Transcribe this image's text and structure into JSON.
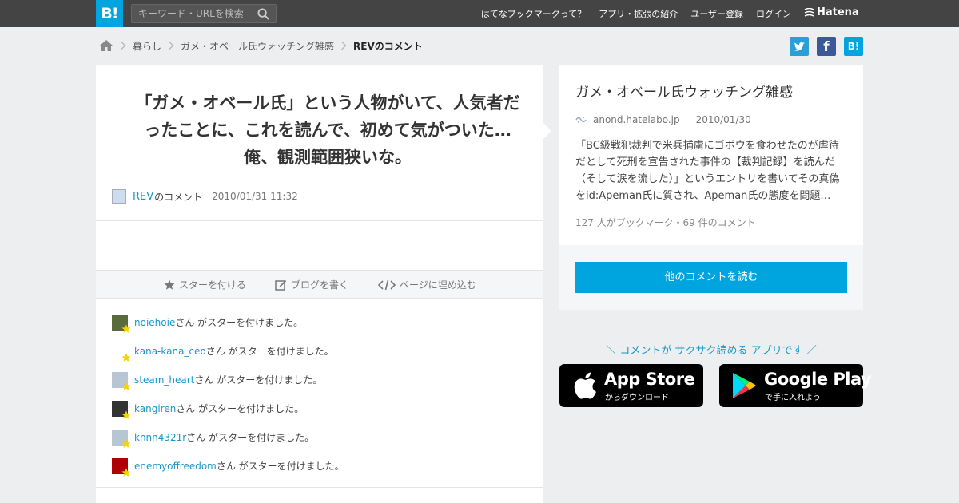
{
  "header": {
    "logo_text": "B!",
    "search_placeholder": "キーワード・URLを検索",
    "nav": [
      "はてなブックマークって？",
      "アプリ・拡張の紹介",
      "ユーザー登録",
      "ログイン"
    ],
    "brand": "Hatena"
  },
  "breadcrumb": {
    "items": [
      "暮らし",
      "ガメ・オベール氏ウォッチング雑感"
    ],
    "current": "REVのコメント"
  },
  "share": {
    "facebook_glyph": "f",
    "hatena_glyph": "B!"
  },
  "comment": {
    "text": "「ガメ・オベール氏」という人物がいて、人気者だったことに、これを読んで、初めて気がついた…　俺、観測範囲狭いな。",
    "user": "REV",
    "user_suffix": "のコメント",
    "date": "2010/01/31 11:32"
  },
  "actions": {
    "star": "スターを付ける",
    "blog": "ブログを書く",
    "embed": "ページに埋め込む"
  },
  "stars": {
    "suffix": "さん がスターを付けました。",
    "users": [
      "noiehoie",
      "kana-kana_ceo",
      "steam_heart",
      "kangiren",
      "knnn4321r",
      "enemyoffreedom"
    ]
  },
  "entry": {
    "title": "ガメ・オベール氏ウォッチング雑感",
    "domain": "anond.hatelabo.jp",
    "date": "2010/01/30",
    "summary": "「BC級戦犯裁判で米兵捕虜にゴボウを食わせたのが虐待だとして死刑を宣告された事件の【裁判記録】を読んだ（そして涙を流した）」というエントリを書いてその真偽をid:Apeman氏に質され、Apeman氏の態度を問題…",
    "count": "127 人がブックマーク・69 件のコメント",
    "read_more": "他のコメントを読む"
  },
  "promo": {
    "text": "＼ コメントが サクサク読める アプリです ／",
    "app_store": {
      "name": "App Store",
      "sub": "からダウンロード"
    },
    "google_play": {
      "name": "Google Play",
      "sub": "で手に入れよう"
    }
  }
}
